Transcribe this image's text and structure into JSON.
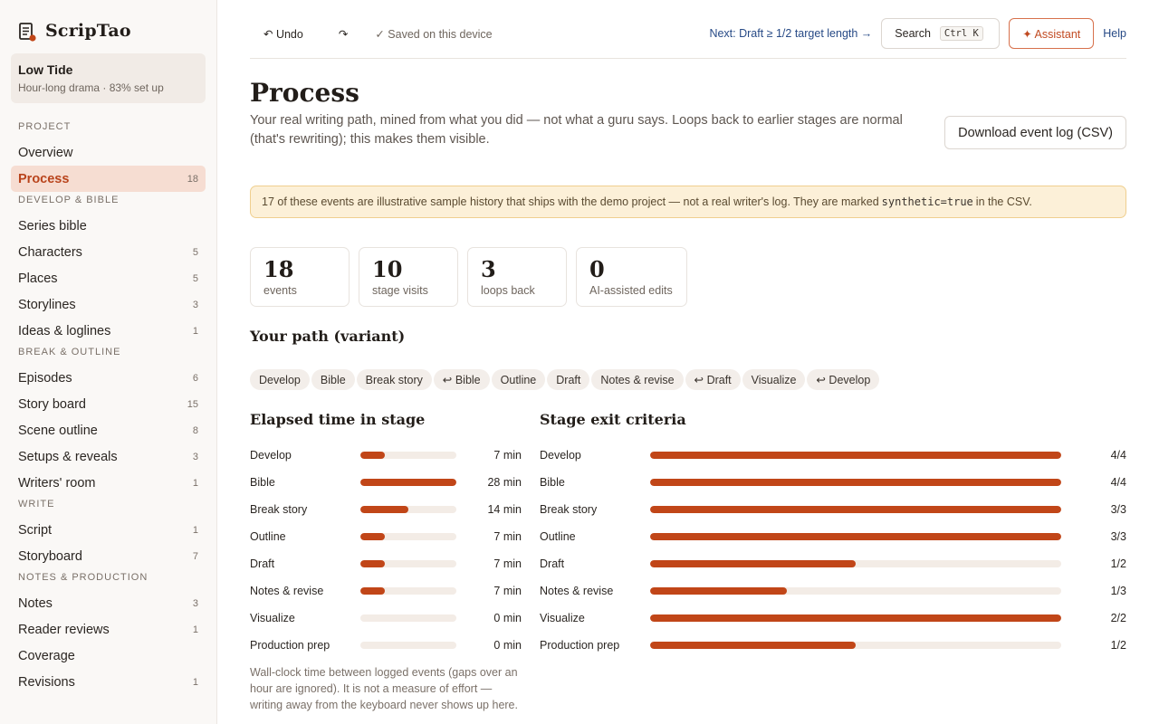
{
  "brand": {
    "name": "ScripTao",
    "icon": "script-doc-icon"
  },
  "project": {
    "title": "Low Tide",
    "subtitle": "Hour-long drama · 83% set up"
  },
  "sidebar": {
    "sections": [
      {
        "title": "PROJECT",
        "items": [
          {
            "label": "Overview",
            "count": ""
          },
          {
            "label": "Process",
            "count": "18",
            "active": true
          }
        ]
      },
      {
        "title": "DEVELOP & BIBLE",
        "items": [
          {
            "label": "Series bible",
            "count": ""
          },
          {
            "label": "Characters",
            "count": "5"
          },
          {
            "label": "Places",
            "count": "5"
          },
          {
            "label": "Storylines",
            "count": "3"
          },
          {
            "label": "Ideas & loglines",
            "count": "1"
          }
        ]
      },
      {
        "title": "BREAK & OUTLINE",
        "items": [
          {
            "label": "Episodes",
            "count": "6"
          },
          {
            "label": "Story board",
            "count": "15"
          },
          {
            "label": "Scene outline",
            "count": "8"
          },
          {
            "label": "Setups & reveals",
            "count": "3"
          },
          {
            "label": "Writers' room",
            "count": "1"
          }
        ]
      },
      {
        "title": "WRITE",
        "items": [
          {
            "label": "Script",
            "count": "1"
          },
          {
            "label": "Storyboard",
            "count": "7"
          }
        ]
      },
      {
        "title": "NOTES & PRODUCTION",
        "items": [
          {
            "label": "Notes",
            "count": "3"
          },
          {
            "label": "Reader reviews",
            "count": "1"
          },
          {
            "label": "Coverage",
            "count": ""
          },
          {
            "label": "Revisions",
            "count": "1"
          }
        ]
      }
    ]
  },
  "toolbar": {
    "undo_label": "↶ Undo",
    "redo_label": "↷",
    "saved_label": "✓ Saved on this device",
    "next_label": "Next: Draft ≥ 1/2 target length →",
    "search_label": "Search",
    "search_kbd": "Ctrl K",
    "assistant_label": "✦ Assistant",
    "help_label": "Help"
  },
  "page": {
    "title": "Process",
    "description": "Your real writing path, mined from what you did — not what a guru says. Loops back to earlier stages are normal (that's rewriting); this makes them visible.",
    "download_label": "Download event log (CSV)"
  },
  "notice": {
    "before": "17 of these events are illustrative sample history that ships with the demo project — not a real writer's log. They are marked",
    "code": "synthetic=true",
    "after": "in the CSV."
  },
  "stats": [
    {
      "value": "18",
      "label": "events"
    },
    {
      "value": "10",
      "label": "stage visits"
    },
    {
      "value": "3",
      "label": "loops back"
    },
    {
      "value": "0",
      "label": "AI-assisted edits"
    }
  ],
  "path": {
    "heading": "Your path (variant)",
    "chips": [
      "Develop",
      "Bible",
      "Break story",
      "↩ Bible",
      "Outline",
      "Draft",
      "Notes & revise",
      "↩ Draft",
      "Visualize",
      "↩ Develop"
    ]
  },
  "elapsed": {
    "heading": "Elapsed time in stage",
    "max": 28,
    "rows": [
      {
        "label": "Develop",
        "minutes": 7,
        "text": "7 min"
      },
      {
        "label": "Bible",
        "minutes": 28,
        "text": "28 min"
      },
      {
        "label": "Break story",
        "minutes": 14,
        "text": "14 min"
      },
      {
        "label": "Outline",
        "minutes": 7,
        "text": "7 min"
      },
      {
        "label": "Draft",
        "minutes": 7,
        "text": "7 min"
      },
      {
        "label": "Notes & revise",
        "minutes": 7,
        "text": "7 min"
      },
      {
        "label": "Visualize",
        "minutes": 0,
        "text": "0 min"
      },
      {
        "label": "Production prep",
        "minutes": 0,
        "text": "0 min"
      }
    ],
    "footnote": "Wall-clock time between logged events (gaps over an hour are ignored). It is not a measure of effort — writing away from the keyboard never shows up here."
  },
  "exit": {
    "heading": "Stage exit criteria",
    "rows": [
      {
        "label": "Develop",
        "done": 4,
        "total": 4,
        "text": "4/4"
      },
      {
        "label": "Bible",
        "done": 4,
        "total": 4,
        "text": "4/4"
      },
      {
        "label": "Break story",
        "done": 3,
        "total": 3,
        "text": "3/3"
      },
      {
        "label": "Outline",
        "done": 3,
        "total": 3,
        "text": "3/3"
      },
      {
        "label": "Draft",
        "done": 1,
        "total": 2,
        "text": "1/2"
      },
      {
        "label": "Notes & revise",
        "done": 1,
        "total": 3,
        "text": "1/3"
      },
      {
        "label": "Visualize",
        "done": 2,
        "total": 2,
        "text": "2/2"
      },
      {
        "label": "Production prep",
        "done": 1,
        "total": 2,
        "text": "1/2"
      }
    ]
  },
  "colors": {
    "accent": "#c14618",
    "link": "#274a86",
    "notice_bg": "#fcf0d8"
  }
}
